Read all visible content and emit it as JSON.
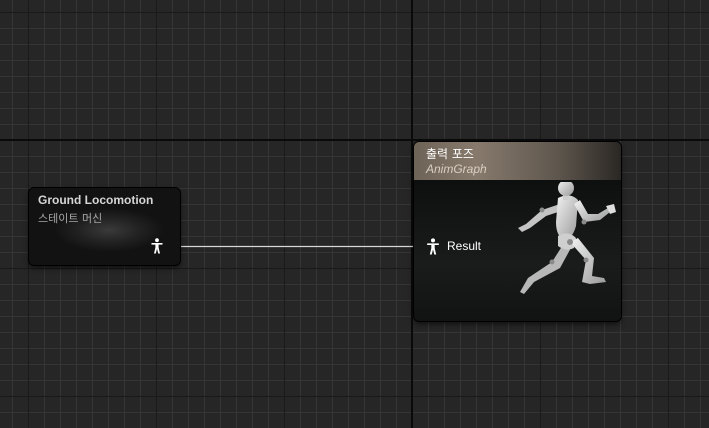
{
  "graph": {
    "state_machine_node": {
      "title": "Ground Locomotion",
      "subtitle": "스테이트 머신",
      "output_pin_icon": "pose-pin-icon"
    },
    "output_pose_node": {
      "title": "출력 포즈",
      "subtitle": "AnimGraph",
      "input_pin_label": "Result",
      "input_pin_icon": "pose-pin-icon",
      "preview_icon": "running-mannequin-icon"
    },
    "colors": {
      "background": "#262626",
      "grid_minor": "#353535",
      "grid_major": "#1a1a1a",
      "wire": "#d8d8d8",
      "output_header": "#877a6d"
    }
  }
}
